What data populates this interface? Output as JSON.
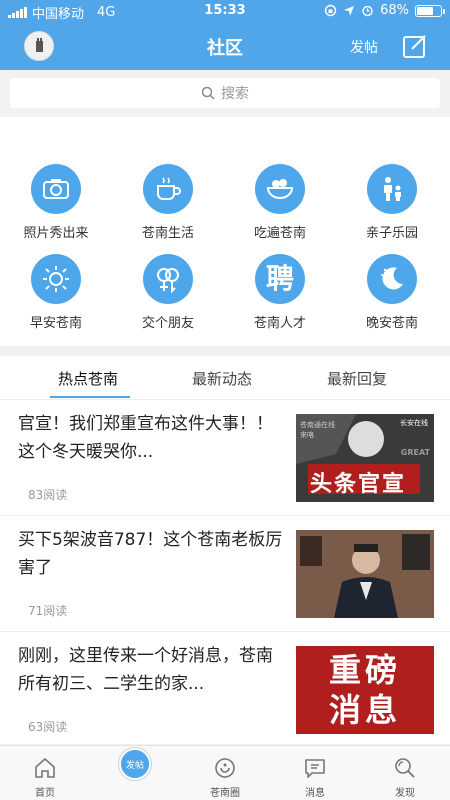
{
  "status": {
    "carrier": "中国移动",
    "network": "4G",
    "time": "15:33",
    "battery": "68%",
    "battery_level": 0.68
  },
  "header": {
    "title": "社区",
    "post_label": "发帖",
    "avatar_icon": "avatar-icon",
    "edit_icon": "edit-icon"
  },
  "search": {
    "placeholder": "搜索"
  },
  "categories": [
    {
      "label": "照片秀出来",
      "icon": "camera-icon"
    },
    {
      "label": "苍南生活",
      "icon": "coffee-cup-icon"
    },
    {
      "label": "吃遍苍南",
      "icon": "food-bowl-icon"
    },
    {
      "label": "亲子乐园",
      "icon": "parent-child-icon"
    },
    {
      "label": "早安苍南",
      "icon": "sun-icon"
    },
    {
      "label": "交个朋友",
      "icon": "gender-icon"
    },
    {
      "label": "苍南人才",
      "icon": "recruit-icon",
      "icon_text": "聘"
    },
    {
      "label": "晚安苍南",
      "icon": "moon-icon"
    }
  ],
  "tabs": [
    {
      "label": "热点苍南",
      "active": true
    },
    {
      "label": "最新动态",
      "active": false
    },
    {
      "label": "最新回复",
      "active": false
    }
  ],
  "feed": [
    {
      "title": "官宣！我们郑重宣布这件大事！！这个冬天暖哭你...",
      "reads": "83阅读",
      "thumb_text": "头条官宣",
      "thumb_small": [
        "苍南通在线",
        "来咯",
        "GREAT",
        "长安在线"
      ]
    },
    {
      "title": "买下5架波音787！这个苍南老板厉害了",
      "reads": "71阅读"
    },
    {
      "title": "刚刚，这里传来一个好消息，苍南所有初三、二学生的家...",
      "reads": "63阅读",
      "thumb_lines": [
        "重磅",
        "消息"
      ]
    }
  ],
  "tabbar": [
    {
      "label": "首页",
      "icon": "home-icon"
    },
    {
      "label": "",
      "icon": "post-button"
    },
    {
      "label": "苍南圈",
      "icon": "circle-refresh-icon"
    },
    {
      "label": "消息",
      "icon": "message-icon"
    },
    {
      "label": "发现",
      "icon": "discover-icon"
    }
  ],
  "fab_label": "发帖",
  "colors": {
    "accent": "#51a6ea",
    "icon_bg": "#4ea6eb",
    "headline_red": "#b01e1e"
  }
}
